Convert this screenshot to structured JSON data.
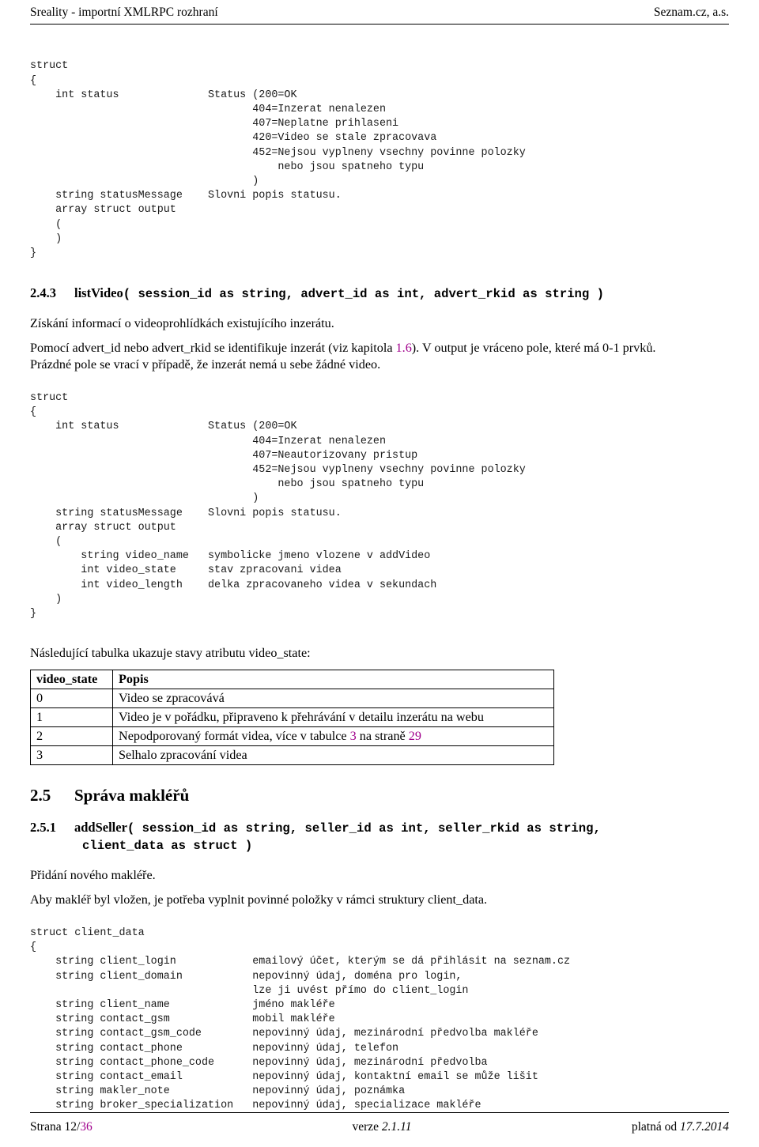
{
  "header": {
    "left": "Sreality - importní XMLRPC rozhraní",
    "right": "Seznam.cz, a.s."
  },
  "code_block_1": "struct\n{\n    int status              Status (200=OK\n                                   404=Inzerat nenalezen\n                                   407=Neplatne prihlaseni\n                                   420=Video se stale zpracovava\n                                   452=Nejsou vyplneny vsechny povinne polozky\n                                       nebo jsou spatneho typu\n                                   )\n    string statusMessage    Slovni popis statusu.\n    array struct output\n    (\n    )\n}",
  "section_2_4_3": {
    "number": "2.4.3",
    "name": "listVideo",
    "signature": "( session_id as string, advert_id as int, advert_rkid as string )",
    "para1": "Získání informací o videoprohlídkách existujícího inzerátu.",
    "para2_a": "Pomocí advert_id nebo advert_rkid se identifikuje inzerát (viz kapitola ",
    "para2_link": "1.6",
    "para2_b": "). V output je vráceno pole, které má 0-1 prvků.",
    "para3": "Prázdné pole se vrací v případě, že inzerát nemá u sebe žádné video."
  },
  "code_block_2": "struct\n{\n    int status              Status (200=OK\n                                   404=Inzerat nenalezen\n                                   407=Neautorizovany pristup\n                                   452=Nejsou vyplneny vsechny povinne polozky\n                                       nebo jsou spatneho typu\n                                   )\n    string statusMessage    Slovni popis statusu.\n    array struct output\n    (\n        string video_name   symbolicke jmeno vlozene v addVideo\n        int video_state     stav zpracovani videa\n        int video_length    delka zpracovaneho videa v sekundach\n    )\n}",
  "table_intro": "Následující tabulka ukazuje stavy atributu video_state:",
  "table": {
    "headers": [
      "video_state",
      "Popis"
    ],
    "rows": [
      {
        "state": "0",
        "desc": "Video se zpracovává"
      },
      {
        "state": "1",
        "desc": "Video je v pořádku, připraveno k přehrávání v detailu inzerátu na webu"
      },
      {
        "state": "2",
        "desc_a": "Nepodporovaný formát videa, více v tabulce ",
        "link1": "3",
        "desc_b": " na straně ",
        "link2": "29",
        "desc_c": ""
      },
      {
        "state": "3",
        "desc": "Selhalo zpracování videa"
      }
    ]
  },
  "section_2_5": {
    "number": "2.5",
    "title": "Správa makléřů"
  },
  "section_2_5_1": {
    "number": "2.5.1",
    "name": "addSeller",
    "signature_line1": "( session_id as string, seller_id as int, seller_rkid as string,",
    "signature_line2": "client_data as struct )",
    "para1": "Přidání nového makléře.",
    "para2": "Aby makléř byl vložen, je potřeba vyplnit povinné položky v rámci struktury client_data."
  },
  "code_block_3": "struct client_data\n{\n    string client_login            emailový účet, kterým se dá přihlásit na seznam.cz\n    string client_domain           nepovinný údaj, doména pro login,\n                                   lze ji uvést přímo do client_login\n    string client_name             jméno makléře\n    string contact_gsm             mobil makléře\n    string contact_gsm_code        nepovinný údaj, mezinárodní předvolba makléře\n    string contact_phone           nepovinný údaj, telefon\n    string contact_phone_code      nepovinný údaj, mezinárodní předvolba\n    string contact_email           nepovinný údaj, kontaktní email se může lišit\n    string makler_note             nepovinný údaj, poznámka\n    string broker_specialization   nepovinný údaj, specializace makléře",
  "footer": {
    "page_label": "Strana ",
    "page_current": "12",
    "page_sep": "/",
    "page_total": "36",
    "version_label": "verze ",
    "version_value": "2.1.11",
    "valid_label": "platná od ",
    "valid_value": "17.7.2014"
  },
  "colors": {
    "link": "#a0008c",
    "text": "#000000",
    "code": "#1a1a1a"
  }
}
